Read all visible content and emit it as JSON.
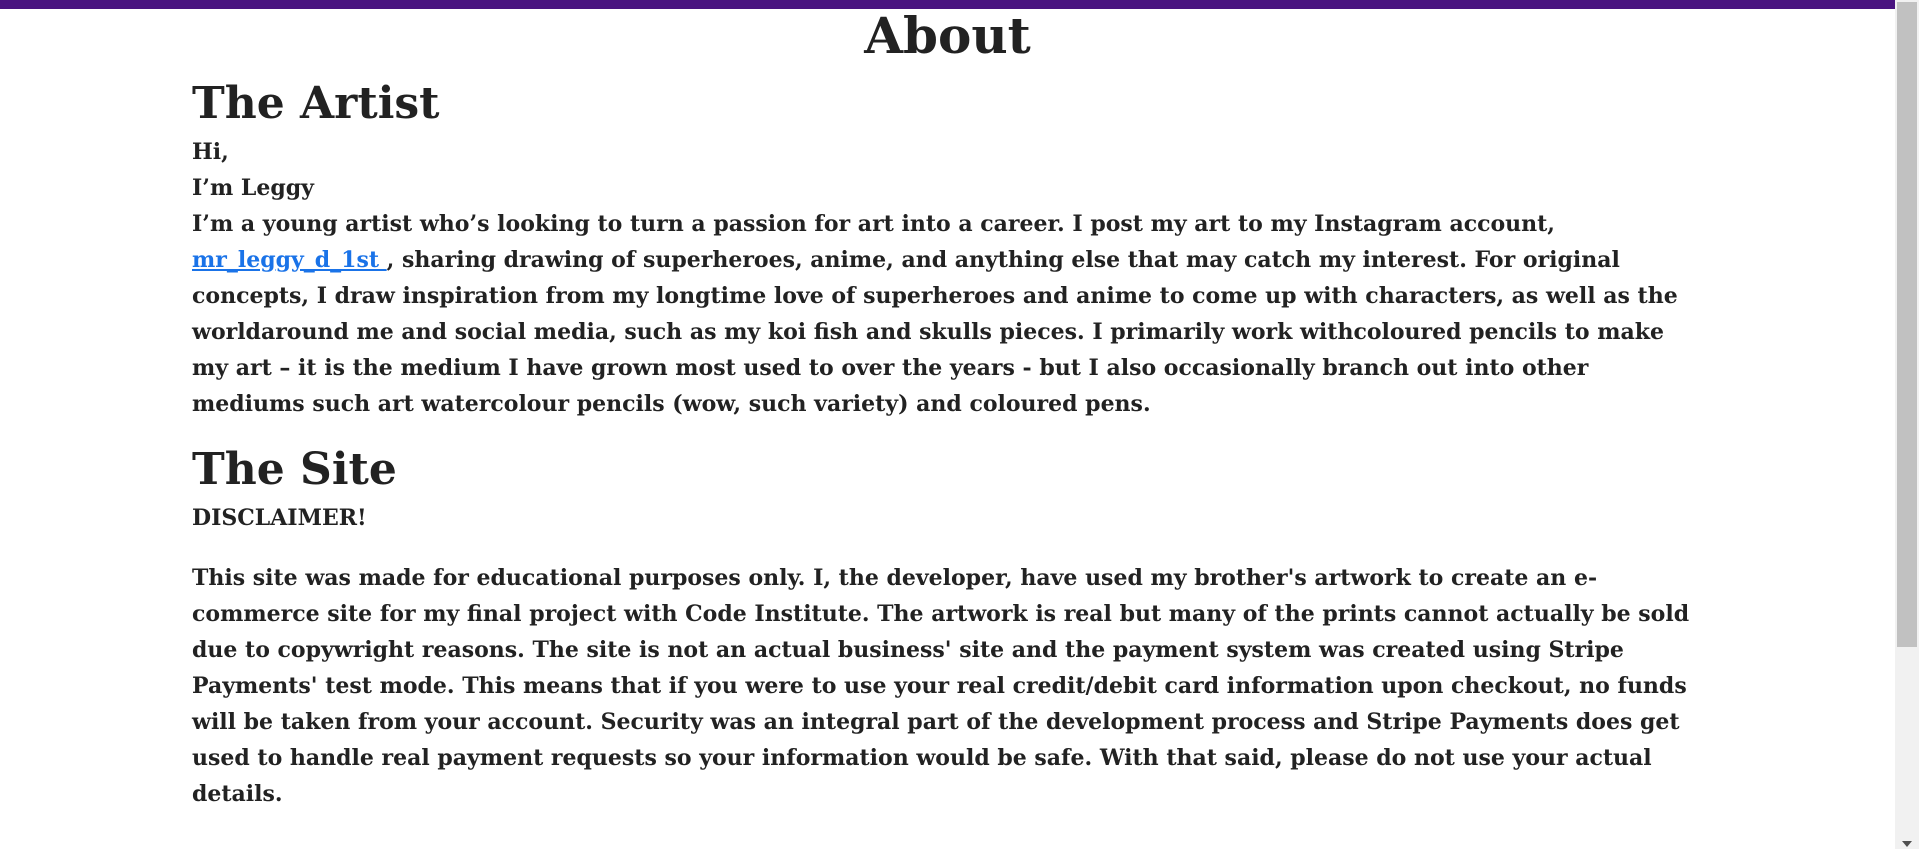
{
  "colors": {
    "top_bar": "#4a1480",
    "link": "#1a73e8",
    "text": "#222222"
  },
  "page": {
    "title": "About"
  },
  "artist": {
    "heading": "The Artist",
    "greeting": "Hi,",
    "intro": "I’m Leggy",
    "bio_start": "I’m a young artist who’s looking to turn a passion for art into a career. I post my art to my Instagram account, ",
    "instagram_link": "mr_leggy_d_1st ",
    "bio_end": ", sharing drawing of superheroes, anime, and anything else that may catch my interest. For original concepts, I draw inspiration from my longtime love of superheroes and anime to come up with characters, as well as the worldaround me and social media, such as my koi fish and skulls pieces. I primarily work withcoloured pencils to make my art – it is the medium I have grown most used to over the years - but I also occasionally branch out into other mediums such art watercolour pencils (wow, such variety) and coloured pens."
  },
  "site": {
    "heading": "The Site",
    "disclaimer_title": "DISCLAIMER!",
    "disclaimer_text": "This site was made for educational purposes only. I, the developer, have used my brother's artwork to create an e-commerce site for my final project with Code Institute. The artwork is real but many of the prints cannot actually be sold due to copywright reasons. The site is not an actual business' site and the payment system was created using Stripe Payments' test mode. This means that if you were to use your real credit/debit card information upon checkout, no funds will be taken from your account. Security was an integral part of the development process and Stripe Payments does get used to handle real payment requests so your information would be safe. With that said, please do not use your actual details."
  },
  "scrollbar": {
    "icon": "chevron-down-icon"
  }
}
